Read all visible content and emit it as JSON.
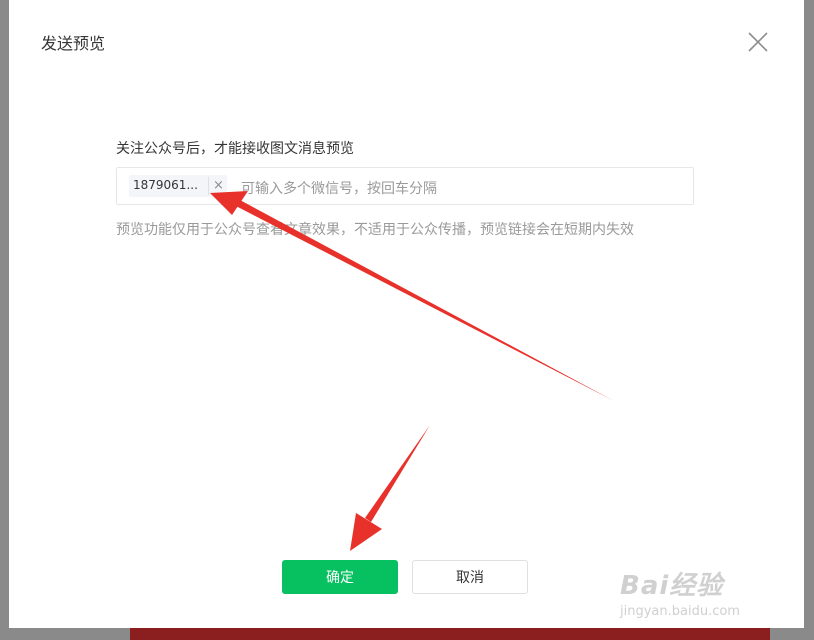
{
  "dialog": {
    "title": "发送预览",
    "hint": "关注公众号后，才能接收图文消息预览",
    "recipient_tag": "1879061...",
    "tag_remove": "×",
    "input_placeholder": "可输入多个微信号，按回车分隔",
    "note": "预览功能仅用于公众号查看文章效果，不适用于公众传播，预览链接会在短期内失效",
    "confirm_label": "确定",
    "cancel_label": "取消"
  },
  "colors": {
    "primary_button": "#07c160",
    "annotation_arrow": "#e8312a"
  },
  "icons": {
    "close": "close-icon"
  },
  "watermark": {
    "brand": "Bai经验",
    "url": "jingyan.baidu.com"
  }
}
